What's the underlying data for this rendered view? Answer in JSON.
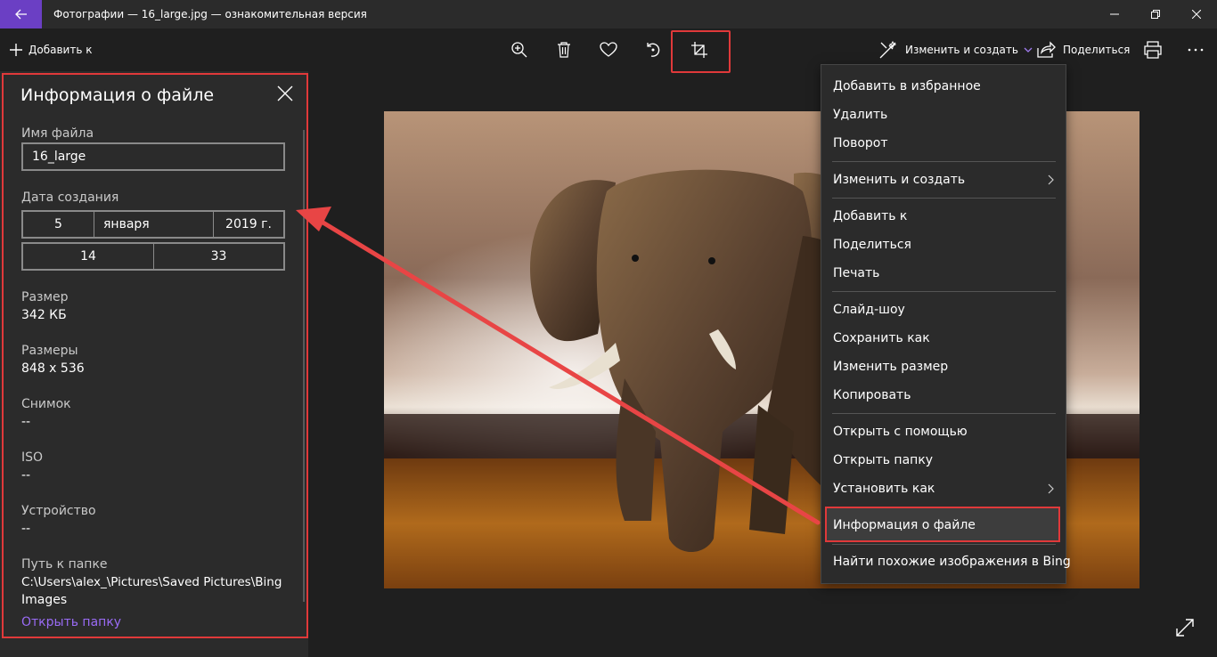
{
  "window": {
    "title": "Фотографии — 16_large.jpg — ознакомительная версия"
  },
  "toolbar": {
    "add_label": "Добавить к",
    "edit_label": "Изменить и создать",
    "share_label": "Поделиться",
    "icons": [
      "zoom-in-icon",
      "delete-icon",
      "heart-icon",
      "rotate-icon",
      "crop-icon",
      "print-icon",
      "more-icon"
    ]
  },
  "info_panel": {
    "title": "Информация о файле",
    "filename_label": "Имя файла",
    "filename_value": "16_large",
    "date_label": "Дата создания",
    "date_day": "5",
    "date_month": "января",
    "date_year": "2019 г.",
    "time_hour": "14",
    "time_minute": "33",
    "size_label": "Размер",
    "size_value": "342 КБ",
    "dimensions_label": "Размеры",
    "dimensions_value": "848 x 536",
    "shot_label": "Снимок",
    "shot_value": "--",
    "iso_label": "ISO",
    "iso_value": "--",
    "device_label": "Устройство",
    "device_value": "--",
    "path_label": "Путь к папке",
    "path_line1": "C:\\Users\\alex_\\Pictures\\Saved Pictures\\Bing",
    "path_line2": "Images",
    "open_folder": "Открыть папку"
  },
  "context_menu": {
    "items": [
      "Добавить в избранное",
      "Удалить",
      "Поворот",
      "Изменить и создать",
      "Добавить к",
      "Поделиться",
      "Печать",
      "Слайд-шоу",
      "Сохранить как",
      "Изменить размер",
      "Копировать",
      "Открыть с помощью",
      "Открыть папку",
      "Установить как",
      "Информация о файле",
      "Найти похожие изображения в Bing"
    ],
    "highlighted": "Информация о файле"
  },
  "colors": {
    "accent": "#6b3fc4",
    "highlight_box": "#e0393a",
    "link": "#9a6bf5"
  }
}
